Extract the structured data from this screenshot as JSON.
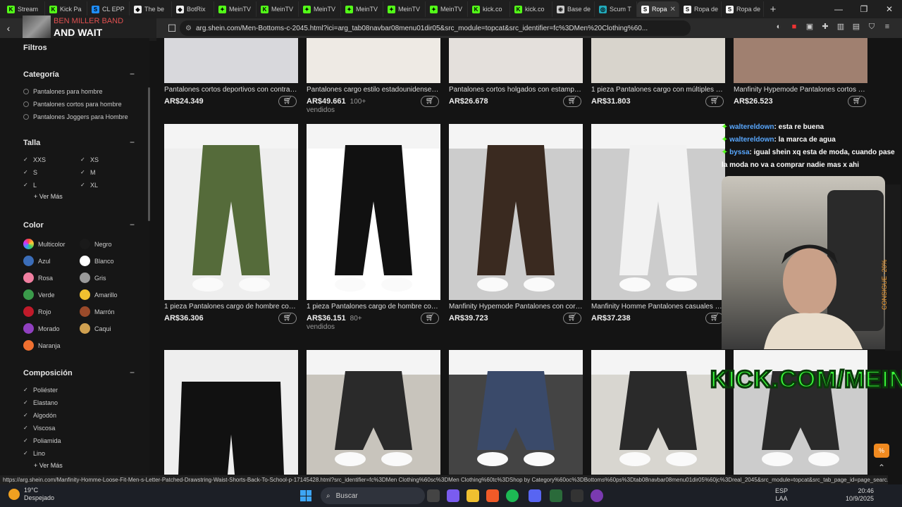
{
  "tabs": [
    {
      "label": "Stream",
      "color": "#53fc18",
      "glyph": "K"
    },
    {
      "label": "Kick Pa",
      "color": "#53fc18",
      "glyph": "K"
    },
    {
      "label": "CL EPP",
      "color": "#1f8fff",
      "glyph": "S"
    },
    {
      "label": "The be",
      "color": "#eee",
      "glyph": "◆"
    },
    {
      "label": "BotRix",
      "color": "#eee",
      "glyph": "◆"
    },
    {
      "label": "MeinTV",
      "color": "#53fc18",
      "glyph": "✦"
    },
    {
      "label": "MeinTV",
      "color": "#53fc18",
      "glyph": "K"
    },
    {
      "label": "MeinTV",
      "color": "#53fc18",
      "glyph": "✦"
    },
    {
      "label": "MeinTV",
      "color": "#53fc18",
      "glyph": "✦"
    },
    {
      "label": "MeinTV",
      "color": "#53fc18",
      "glyph": "✦"
    },
    {
      "label": "MeinTV",
      "color": "#53fc18",
      "glyph": "✦"
    },
    {
      "label": "kick.co",
      "color": "#53fc18",
      "glyph": "K"
    },
    {
      "label": "kick.co",
      "color": "#53fc18",
      "glyph": "K"
    },
    {
      "label": "Base de",
      "color": "#ccc",
      "glyph": "⊕"
    },
    {
      "label": "Scum T",
      "color": "#2ab",
      "glyph": "◎"
    },
    {
      "label": "Ropa",
      "color": "#fff",
      "glyph": "S",
      "active": true
    },
    {
      "label": "Ropa de",
      "color": "#fff",
      "glyph": "S"
    },
    {
      "label": "Ropa de",
      "color": "#fff",
      "glyph": "S"
    }
  ],
  "url": "arg.shein.com/Men-Bottoms-c-2045.html?ici=arg_tab08navbar08menu01dir05&src_module=topcat&src_identifier=fc%3DMen%20Clothing%60...",
  "now_playing": {
    "artist": "BEN MILLER BAND",
    "title": "AND WAIT"
  },
  "sidebar": {
    "filtros": "Filtros",
    "categoria": {
      "title": "Categoría",
      "items": [
        "Pantalones para hombre",
        "Pantalones cortos para hombre",
        "Pantalones Joggers para Hombre"
      ]
    },
    "talla": {
      "title": "Talla",
      "items": [
        "XXS",
        "XS",
        "S",
        "M",
        "L",
        "XL"
      ],
      "more": "+ Ver Más"
    },
    "color": {
      "title": "Color",
      "items": [
        {
          "label": "Multicolor",
          "hex": "conic"
        },
        {
          "label": "Negro",
          "hex": "#1a1a1a"
        },
        {
          "label": "Azul",
          "hex": "#3b6db8"
        },
        {
          "label": "Blanco",
          "hex": "#ffffff"
        },
        {
          "label": "Rosa",
          "hex": "#f07fa0"
        },
        {
          "label": "Gris",
          "hex": "#9a9a9a"
        },
        {
          "label": "Verde",
          "hex": "#3a9a4a"
        },
        {
          "label": "Amarillo",
          "hex": "#f0c030"
        },
        {
          "label": "Rojo",
          "hex": "#c01a2a"
        },
        {
          "label": "Marrón",
          "hex": "#9a4a2a"
        },
        {
          "label": "Morado",
          "hex": "#9040c0"
        },
        {
          "label": "Caqui",
          "hex": "#d0a050"
        },
        {
          "label": "Naranja",
          "hex": "#f07030"
        }
      ]
    },
    "composicion": {
      "title": "Composición",
      "items": [
        "Poliéster",
        "Elastano",
        "Algodón",
        "Viscosa",
        "Poliamida",
        "Lino"
      ],
      "more": "+ Ver Más"
    }
  },
  "products_row1": [
    {
      "title": "Pantalones cortos deportivos con contraste...",
      "price": "AR$24.349",
      "sold": ""
    },
    {
      "title": "Pantalones cargo estilo estadounidense de...",
      "price": "AR$49.661",
      "sold": "100+ vendidos"
    },
    {
      "title": "Pantalones cortos holgados con estampad...",
      "price": "AR$26.678",
      "sold": ""
    },
    {
      "title": "1 pieza Pantalones cargo con múltiples bol...",
      "price": "AR$31.803",
      "sold": ""
    },
    {
      "title": "Manfinity Hypemode Pantalones cortos co...",
      "price": "AR$26.523",
      "sold": ""
    }
  ],
  "products_row2": [
    {
      "title": "1 pieza Pantalones cargo de hombre con c...",
      "price": "AR$36.306",
      "sold": ""
    },
    {
      "title": "1 pieza Pantalones cargo de hombre con ...",
      "price": "AR$36.151",
      "sold": "80+ vendidos"
    },
    {
      "title": "Manfinity Hypemode Pantalones con cordó...",
      "price": "AR$39.723",
      "sold": ""
    },
    {
      "title": "Manfinity Homme Pantalones casuales de ...",
      "price": "AR$37.238",
      "sold": ""
    }
  ],
  "chat": [
    {
      "user": "waltereldown",
      "msg": ": esta re buena"
    },
    {
      "user": "waltereldown",
      "msg": ": la marca de agua"
    },
    {
      "user": "byssa",
      "msg": ": igual shein xq esta de moda, cuando pase la moda no va a comprar nadie mas x ahi"
    }
  ],
  "stream": {
    "brand": "KICK.COM/MEINTV",
    "side_text": "CONSIGUE -20%"
  },
  "statusbar": "https://arg.shein.com/Manfinity-Homme-Loose-Fit-Men-s-Letter-Patched-Drawstring-Waist-Shorts-Back-To-School-p-17145428.html?src_identifier=fc%3DMen Clothing%60sc%3DMen Clothing%60tc%3DShop by Category%60oc%3DBottoms%60ps%3Dtab08navbar08menu01dir05%60jc%3Dreal_2045&src_module=topcat&src_tab_page_id=page_searc...",
  "taskbar": {
    "temp": "19°C",
    "weather": "Despejado",
    "search": "Buscar",
    "lang1": "ESP",
    "lang2": "LAA",
    "time": "20:46",
    "date": "10/9/2025"
  }
}
